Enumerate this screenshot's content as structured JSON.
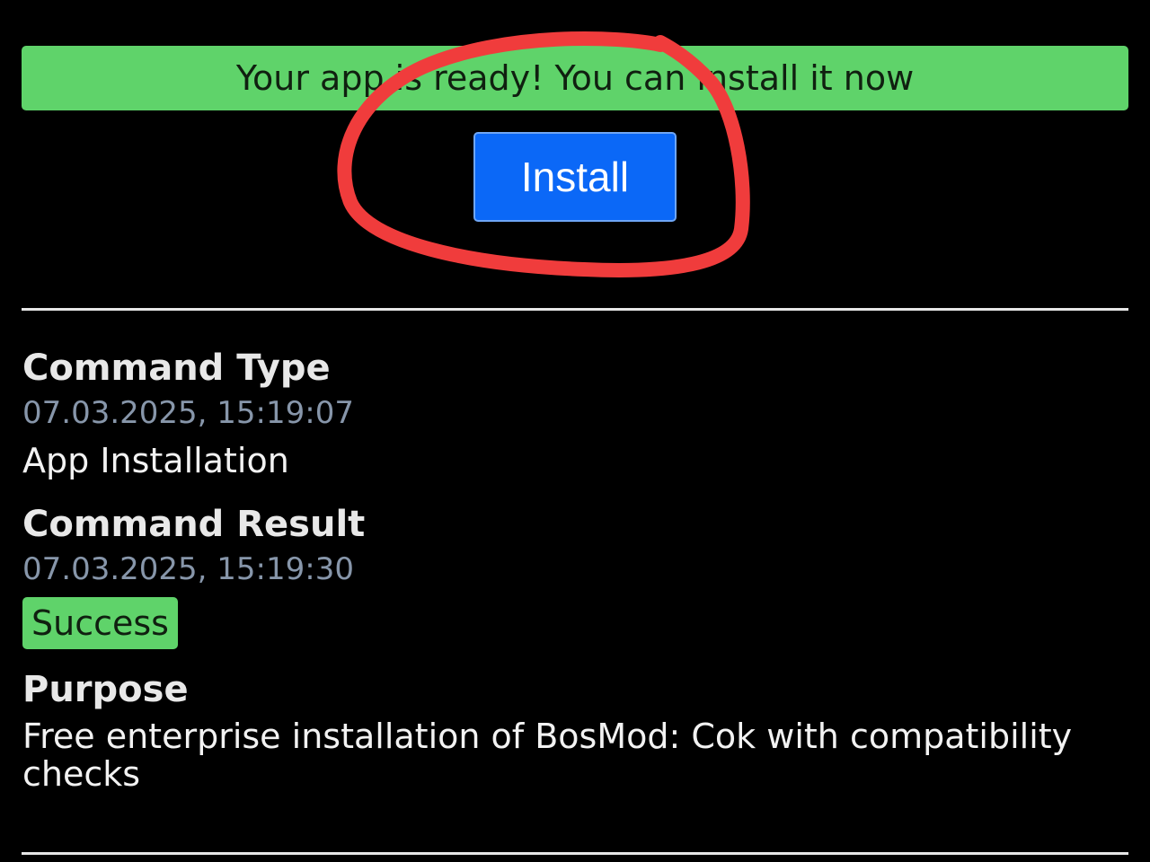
{
  "banner": {
    "message": "Your app is ready! You can install it now"
  },
  "actions": {
    "install_label": "Install"
  },
  "annotation": {
    "stroke_color": "#f03c3c"
  },
  "details": {
    "command_type": {
      "label": "Command Type",
      "timestamp": "07.03.2025, 15:19:07",
      "value": "App Installation"
    },
    "command_result": {
      "label": "Command Result",
      "timestamp": "07.03.2025, 15:19:30",
      "status": "Success"
    },
    "purpose": {
      "label": "Purpose",
      "value": "Free enterprise installation of BosMod: Cok with compatibility checks"
    }
  },
  "colors": {
    "background": "#000000",
    "success_green": "#5fd36a",
    "primary_blue": "#0b68f7",
    "timestamp_gray": "#8796aa"
  }
}
